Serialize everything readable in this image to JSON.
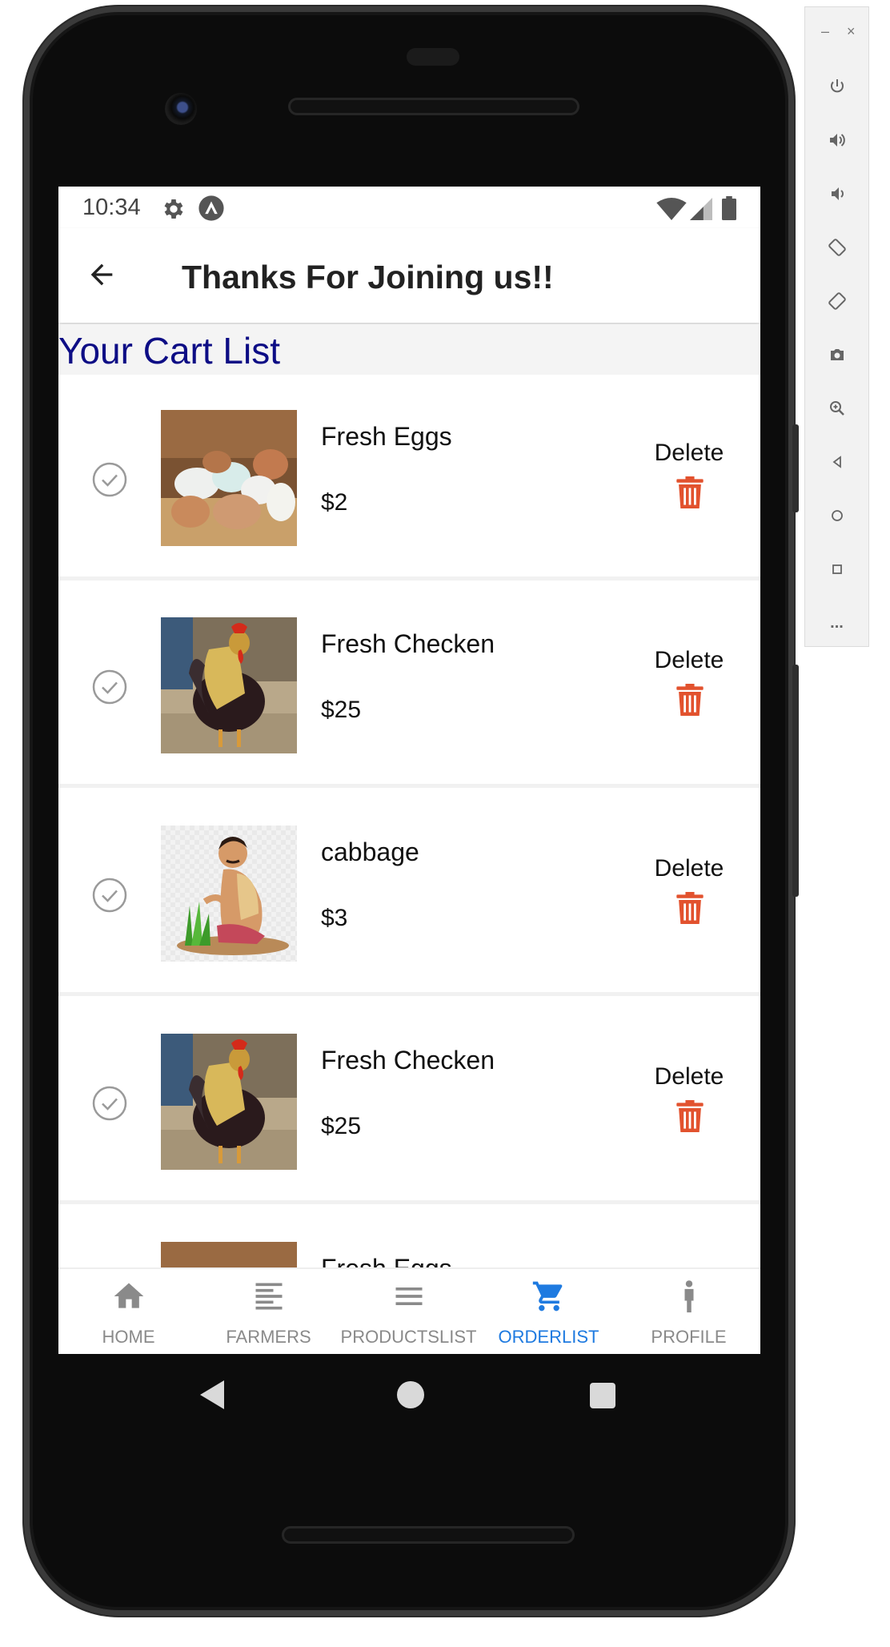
{
  "status_bar": {
    "time": "10:34",
    "icons": [
      "gear-icon",
      "expo-icon",
      "wifi-icon",
      "signal-icon",
      "battery-icon"
    ]
  },
  "header": {
    "title": "Thanks For Joining us!!",
    "back_icon": "back-arrow-icon"
  },
  "section": {
    "title": "Your Cart List",
    "title_color": "#0d0d85"
  },
  "cart": {
    "delete_label": "Delete",
    "delete_color": "#e2522e",
    "items": [
      {
        "name": "Fresh Eggs",
        "price": "$2",
        "image": "eggs"
      },
      {
        "name": "Fresh Checken",
        "price": "$25",
        "image": "rooster"
      },
      {
        "name": "cabbage",
        "price": "$3",
        "image": "farmer"
      },
      {
        "name": "Fresh Checken",
        "price": "$25",
        "image": "rooster"
      },
      {
        "name": "Fresh Eggs",
        "price": "",
        "image": "eggs"
      }
    ]
  },
  "bottom_nav": {
    "active_color": "#1e7ae0",
    "inactive_color": "#8a8a8a",
    "items": [
      {
        "label": "HOME",
        "icon": "home-icon"
      },
      {
        "label": "FARMERS",
        "icon": "align-left-icon"
      },
      {
        "label": "PRODUCTSLIST",
        "icon": "menu-icon"
      },
      {
        "label": "ORDERLIST",
        "icon": "cart-icon",
        "active": true
      },
      {
        "label": "PROFILE",
        "icon": "person-icon"
      }
    ]
  },
  "emulator_panel": {
    "window_controls": [
      "–",
      "×"
    ],
    "buttons": [
      "power-icon",
      "volume-up-icon",
      "volume-down-icon",
      "rotate-left-icon",
      "rotate-right-icon",
      "camera-icon",
      "zoom-icon",
      "back-icon",
      "home-circle-icon",
      "overview-icon",
      "more-icon"
    ],
    "more_label": "..."
  }
}
